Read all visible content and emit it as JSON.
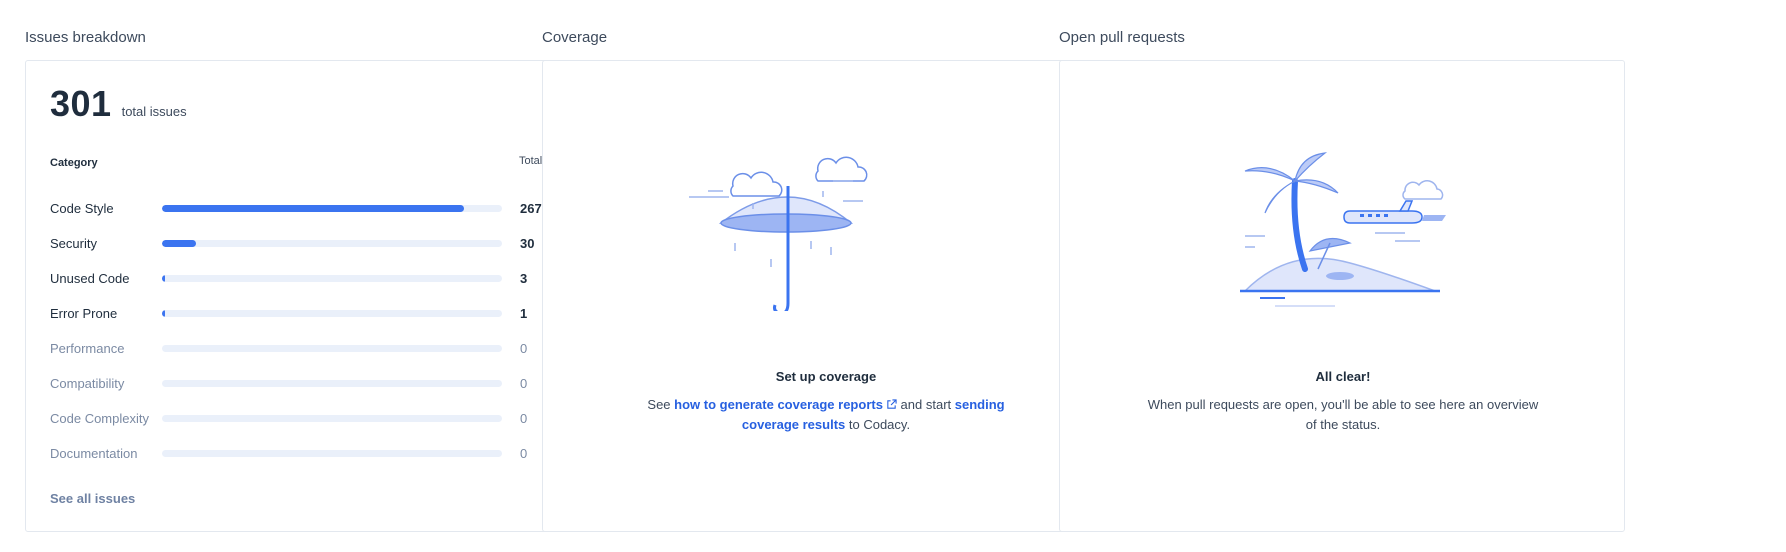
{
  "issues": {
    "title": "Issues breakdown",
    "total": "301",
    "total_label": "total issues",
    "col_category": "Category",
    "col_total": "Total",
    "accent": "#3b74f0",
    "max_value": 301,
    "categories": [
      {
        "name": "Code Style",
        "value": 267
      },
      {
        "name": "Security",
        "value": 30
      },
      {
        "name": "Unused Code",
        "value": 3
      },
      {
        "name": "Error Prone",
        "value": 1
      },
      {
        "name": "Performance",
        "value": 0
      },
      {
        "name": "Compatibility",
        "value": 0
      },
      {
        "name": "Code Complexity",
        "value": 0
      },
      {
        "name": "Documentation",
        "value": 0
      }
    ],
    "see_all": "See all issues"
  },
  "coverage": {
    "title": "Coverage",
    "illustration": "umbrella-rain-icon",
    "heading": "Set up coverage",
    "text_1": "See ",
    "link_1": "how to generate coverage reports",
    "link_1_icon": "external-link-icon",
    "text_2": " and start ",
    "link_2": "sending coverage results",
    "text_3": " to Codacy."
  },
  "pull_requests": {
    "title": "Open pull requests",
    "illustration": "palm-beach-icon",
    "heading": "All clear!",
    "body": "When pull requests are open, you'll be able to see here an overview of the status."
  }
}
